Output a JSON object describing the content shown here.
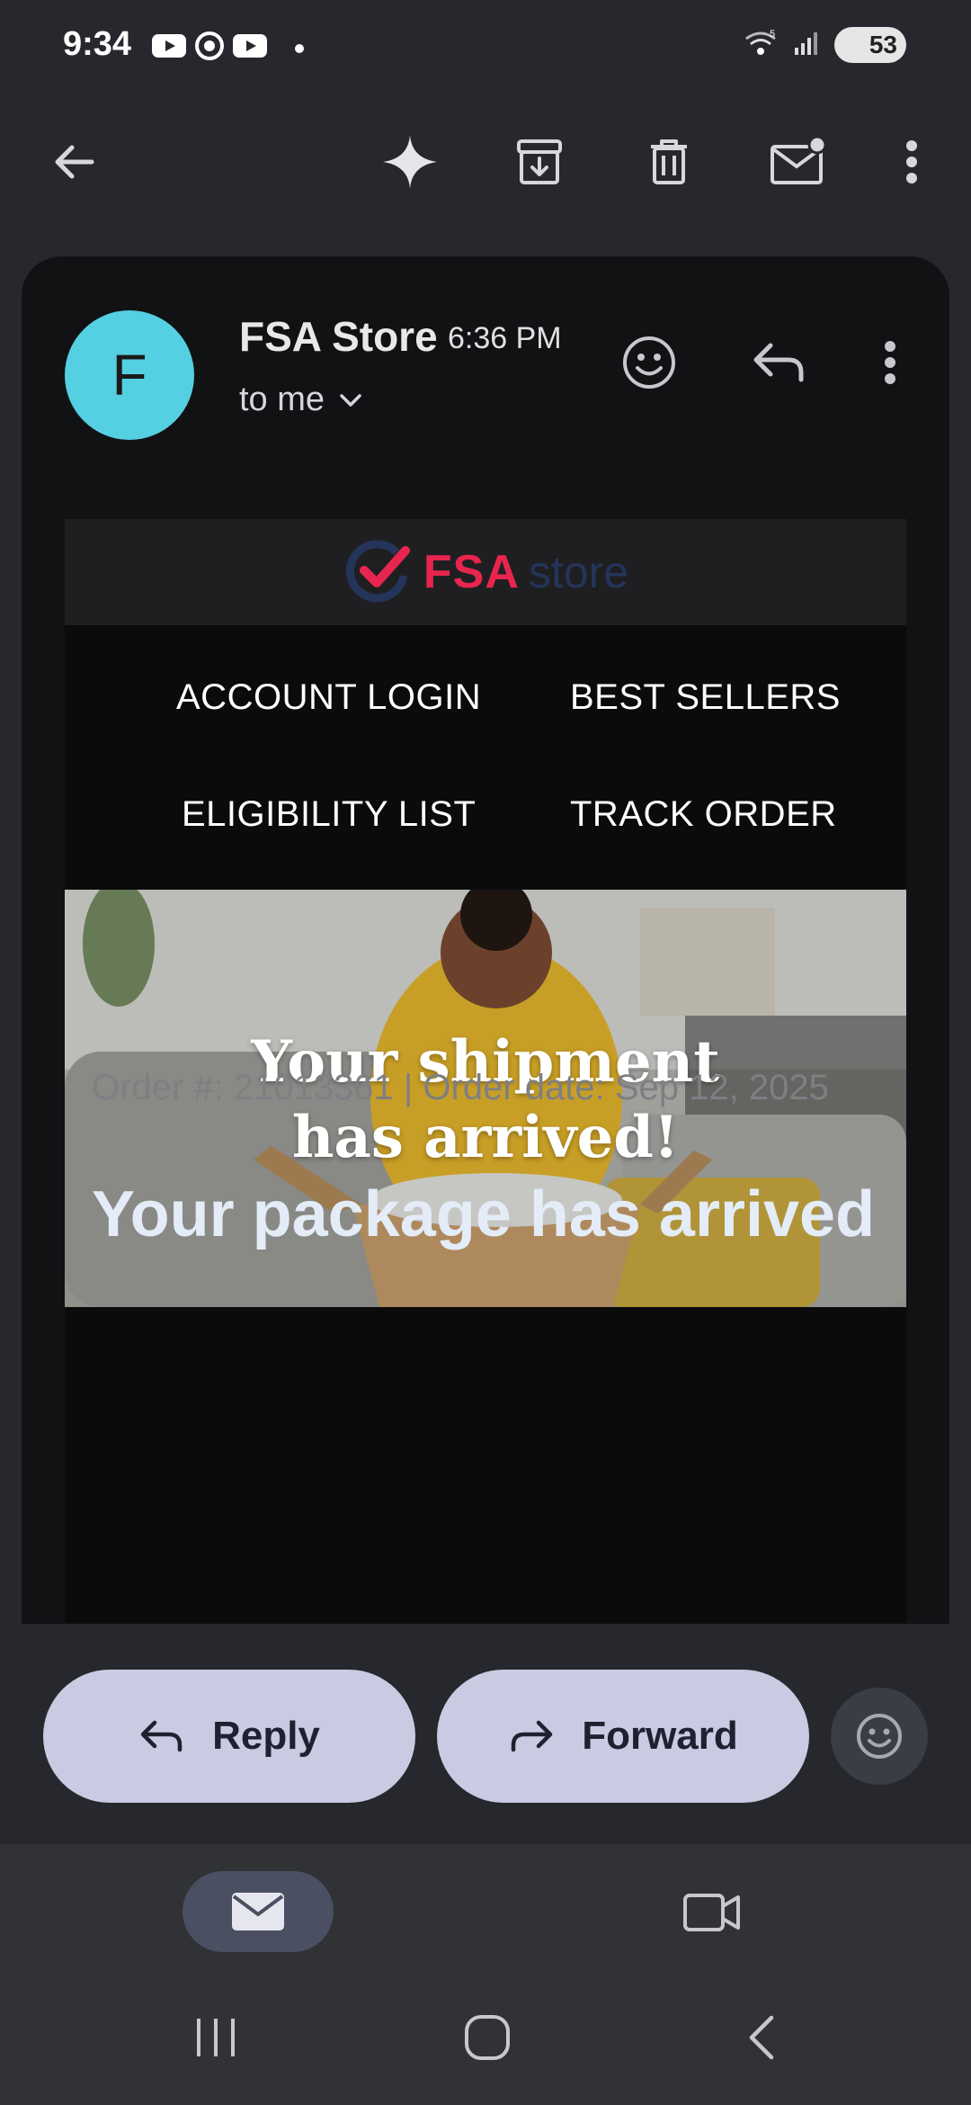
{
  "status_bar": {
    "time": "9:34",
    "battery": "53"
  },
  "email": {
    "sender": "FSA Store",
    "time": "6:36 PM",
    "recipient": "to me",
    "avatar_letter": "F",
    "logo_primary": "FSA",
    "logo_secondary": "store",
    "nav_links": [
      "ACCOUNT LOGIN",
      "BEST SELLERS",
      "ELIGIBILITY LIST",
      "TRACK ORDER"
    ],
    "hero_line1": "Your shipment",
    "hero_line2": "has arrived!",
    "order_line": "Order #: 21013361 | Order date: Sep 12, 2025",
    "package_title": "Your package has arrived"
  },
  "actions": {
    "reply_label": "Reply",
    "forward_label": "Forward"
  },
  "icons": {
    "toolbar": [
      "back-arrow-icon",
      "gemini-sparkle-icon",
      "archive-icon",
      "delete-icon",
      "mark-unread-icon",
      "more-vert-icon"
    ],
    "header": [
      "add-reaction-icon",
      "reply-icon",
      "more-vert-icon"
    ]
  },
  "colors": {
    "avatar": "#55d0e2",
    "pill": "#c9cbe2",
    "logo_red": "#e8254f",
    "background": "#26282d"
  }
}
